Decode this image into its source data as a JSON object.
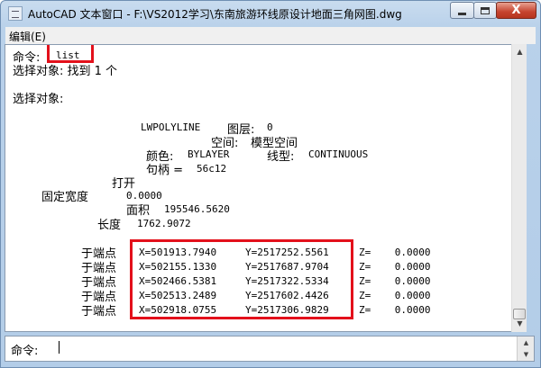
{
  "window": {
    "title": "AutoCAD 文本窗口 - F:\\VS2012学习\\东南旅游环线原设计地面三角网图.dwg",
    "icon": "autocad-app-icon",
    "close_glyph": "X"
  },
  "menubar": {
    "edit_label": "编辑(E)"
  },
  "history": {
    "command_label": "命令:",
    "command_value": "list",
    "select_found": "选择对象: 找到 1 个",
    "select_objects": "选择对象:",
    "entity_type": "LWPOLYLINE",
    "layer_label": "图层:",
    "layer_value": "0",
    "space_label": "空间:",
    "space_value": "模型空间",
    "color_label": "颜色:",
    "color_value": "BYLAYER",
    "linetype_label": "线型:",
    "linetype_value": "CONTINUOUS",
    "handle_label": "句柄 =",
    "handle_value": "56c12",
    "open_label": "打开",
    "width_label": "固定宽度",
    "width_value": "0.0000",
    "area_label": "面积",
    "area_value": "195546.5620",
    "length_label": "长度",
    "length_value": "1762.9072",
    "vertices": [
      {
        "label": "于端点",
        "x": "X=501913.7940",
        "y": "Y=2517252.5561",
        "z": "Z=    0.0000"
      },
      {
        "label": "于端点",
        "x": "X=502155.1330",
        "y": "Y=2517687.9704",
        "z": "Z=    0.0000"
      },
      {
        "label": "于端点",
        "x": "X=502466.5381",
        "y": "Y=2517322.5334",
        "z": "Z=    0.0000"
      },
      {
        "label": "于端点",
        "x": "X=502513.2489",
        "y": "Y=2517602.4426",
        "z": "Z=    0.0000"
      },
      {
        "label": "于端点",
        "x": "X=502918.0755",
        "y": "Y=2517306.9829",
        "z": "Z=    0.0000"
      }
    ]
  },
  "command_line": {
    "prompt": "命令:"
  },
  "highlight_color": "#e3101b"
}
